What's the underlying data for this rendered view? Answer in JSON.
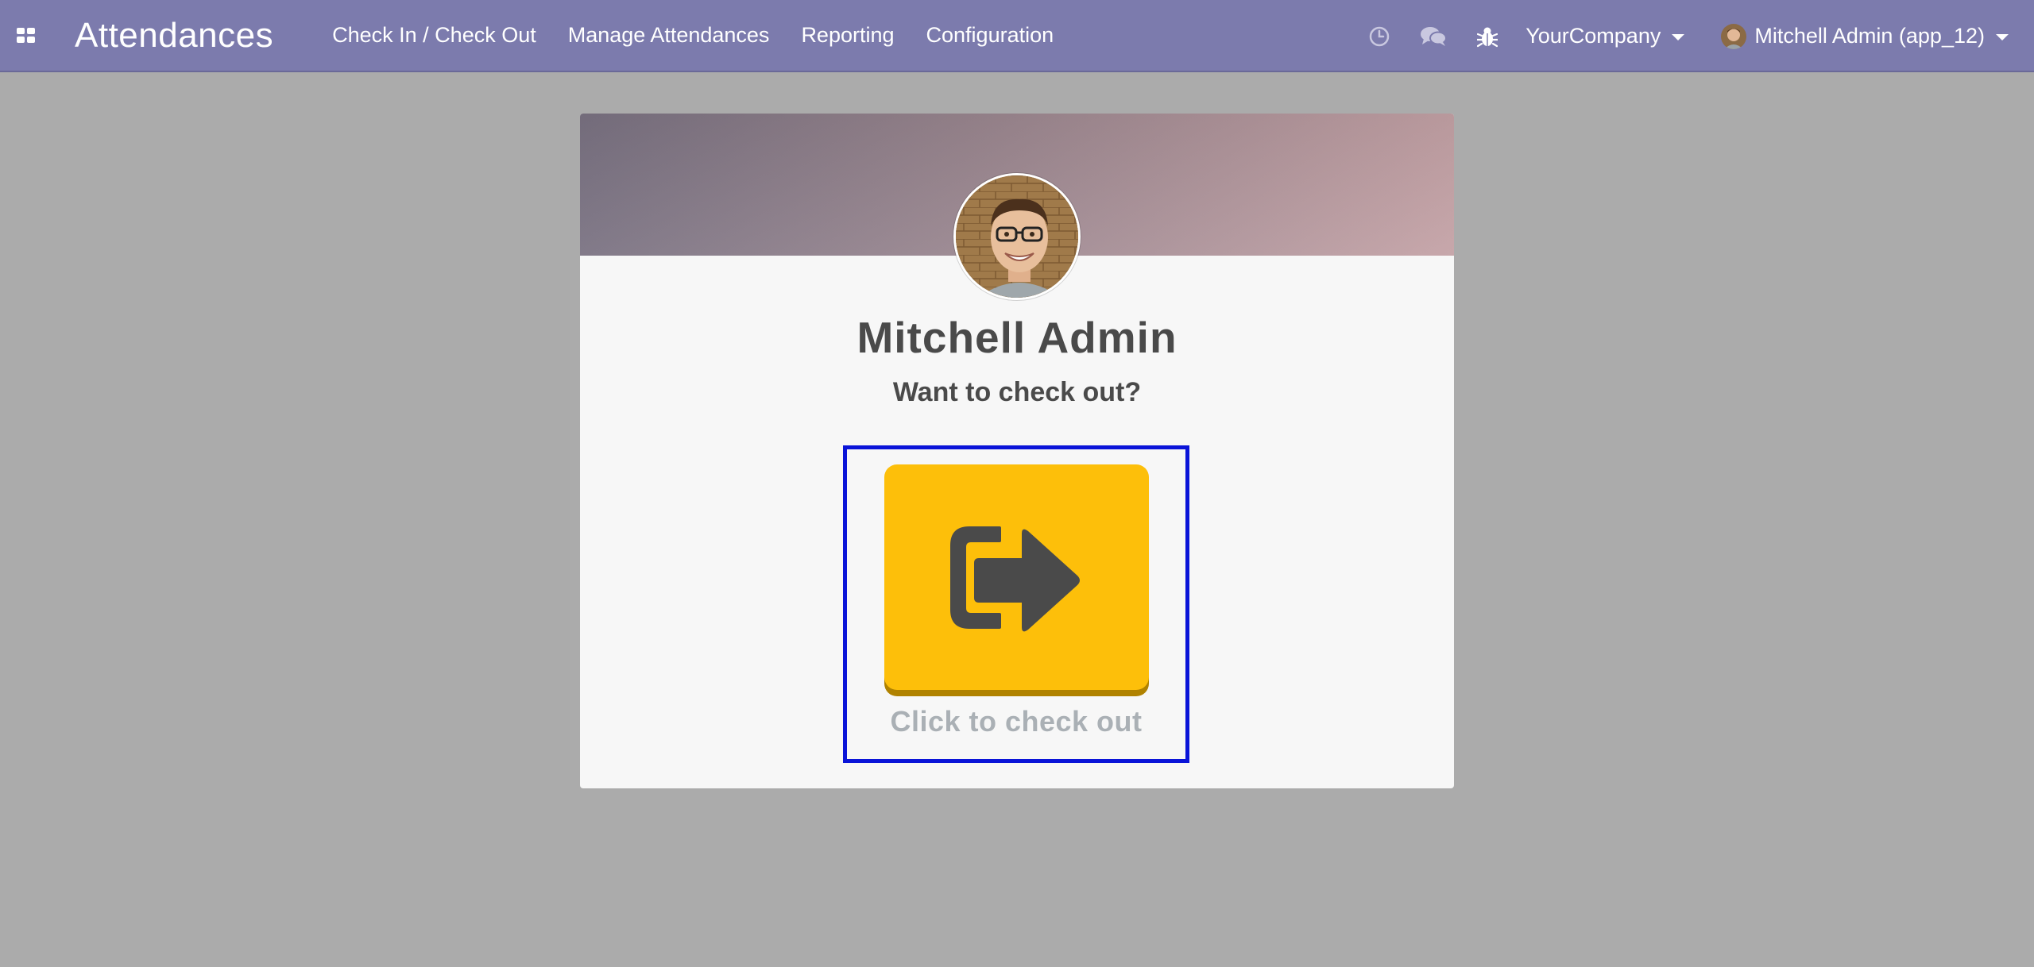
{
  "navbar": {
    "app_title": "Attendances",
    "menu": [
      {
        "label": "Check In / Check Out"
      },
      {
        "label": "Manage Attendances"
      },
      {
        "label": "Reporting"
      },
      {
        "label": "Configuration"
      }
    ],
    "company": "YourCompany",
    "user": "Mitchell Admin (app_12)",
    "icons": [
      "apps-icon",
      "clock-icon",
      "chat-icon",
      "bug-icon"
    ],
    "color": "#7c7bad"
  },
  "card": {
    "employee_name": "Mitchell Admin",
    "prompt": "Want to check out?",
    "button_icon": "sign-out-icon",
    "button_label": "Click to check out",
    "button_color": "#fdbf0a"
  }
}
